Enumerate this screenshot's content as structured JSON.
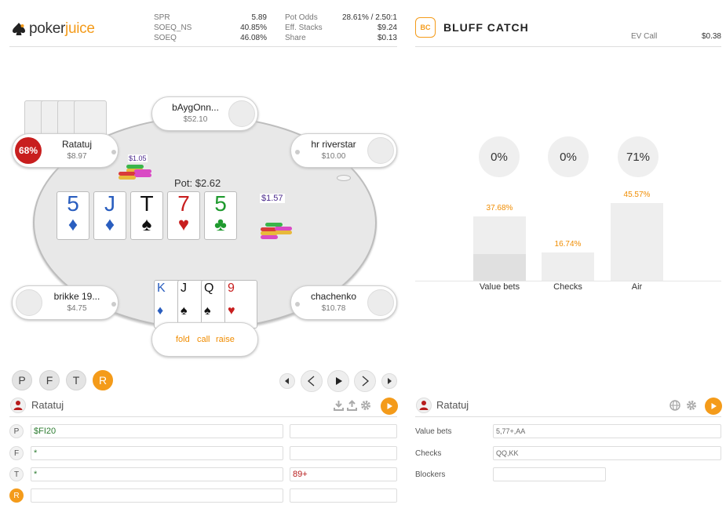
{
  "logo": {
    "poker": "poker",
    "juice": "juice"
  },
  "stats": {
    "spr_label": "SPR",
    "spr_value": "5.89",
    "seqns_label": "SOEQ_NS",
    "seqns_value": "40.85%",
    "seq_label": "SOEQ",
    "seq_value": "46.08%",
    "potodds_label": "Pot Odds",
    "potodds_value": "28.61% / 2.50:1",
    "eff_label": "Eff. Stacks",
    "eff_value": "$9.24",
    "share_label": "Share",
    "share_value": "$0.13"
  },
  "seats": {
    "top": {
      "name": "bAygOnn...",
      "stack": "$52.10"
    },
    "topleft": {
      "name": "Ratatuj",
      "stack": "$8.97",
      "badge": "68%"
    },
    "topright": {
      "name": "hr riverstar",
      "stack": "$10.00"
    },
    "bottomleft": {
      "name": "brikke 19...",
      "stack": "$4.75"
    },
    "bottomright": {
      "name": "chachenko",
      "stack": "$10.78"
    }
  },
  "bets": {
    "ratatuj": "$1.05",
    "center": "$1.57"
  },
  "pot": "Pot: $2.62",
  "board": [
    {
      "rank": "5",
      "suit": "♦",
      "color": "#2a5ebf"
    },
    {
      "rank": "J",
      "suit": "♦",
      "color": "#2a5ebf"
    },
    {
      "rank": "T",
      "suit": "♠",
      "color": "#111"
    },
    {
      "rank": "7",
      "suit": "♥",
      "color": "#c81e1e"
    },
    {
      "rank": "5",
      "suit": "♣",
      "color": "#1f9a2e"
    }
  ],
  "hero_cards": [
    {
      "rank": "K",
      "suit": "♦",
      "color": "#2a5ebf"
    },
    {
      "rank": "J",
      "suit": "♠",
      "color": "#111"
    },
    {
      "rank": "Q",
      "suit": "♠",
      "color": "#111"
    },
    {
      "rank": "9",
      "suit": "♥",
      "color": "#c81e1e"
    }
  ],
  "actions": {
    "fold": "fold",
    "call": "call",
    "raise": "raise"
  },
  "streets": [
    "P",
    "F",
    "T",
    "R"
  ],
  "left_panel": {
    "player": "Ratatuj",
    "rows": [
      {
        "label": "P",
        "range": "$FI20",
        "extra": ""
      },
      {
        "label": "F",
        "range": "*",
        "extra": ""
      },
      {
        "label": "T",
        "range": "*",
        "extra": "89+"
      },
      {
        "label": "R",
        "range": "",
        "extra": ""
      }
    ]
  },
  "bluff": {
    "badge": "BC",
    "title": "BLUFF CATCH",
    "ev_label": "EV Call",
    "ev_value": "$0.38",
    "circles": [
      "0%",
      "0%",
      "71%"
    ],
    "bars": [
      {
        "label": "Value bets",
        "pct": "37.68%",
        "value": 37.68,
        "inner": 15.5
      },
      {
        "label": "Checks",
        "pct": "16.74%",
        "value": 16.74,
        "inner": 0
      },
      {
        "label": "Air",
        "pct": "45.57%",
        "value": 45.57,
        "inner": 0
      }
    ]
  },
  "right_panel": {
    "player": "Ratatuj",
    "rows": [
      {
        "label": "Value bets",
        "value": "5,77+,AA"
      },
      {
        "label": "Checks",
        "value": "QQ,KK"
      },
      {
        "label": "Blockers",
        "value": ""
      }
    ]
  },
  "colors": {
    "accent": "#f49b1a",
    "red_badge": "#c81e1e"
  }
}
